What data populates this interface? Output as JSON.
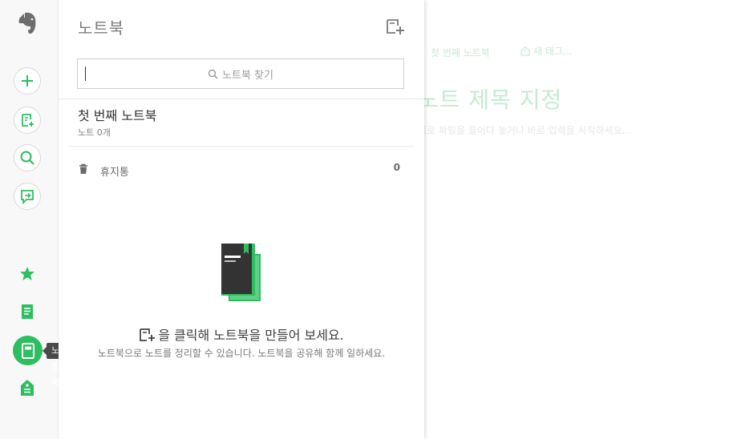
{
  "sidebar": {
    "buttons": [
      {
        "name": "new-note",
        "icon": "plus-icon"
      },
      {
        "name": "new-chat",
        "icon": "note-plus-icon"
      },
      {
        "name": "search",
        "icon": "search-icon"
      },
      {
        "name": "work-chat",
        "icon": "chat-arrow-icon"
      }
    ],
    "nav": [
      {
        "name": "shortcuts",
        "icon": "star-icon"
      },
      {
        "name": "notes",
        "icon": "notes-icon"
      },
      {
        "name": "notebooks",
        "icon": "notebook-icon",
        "active": true
      },
      {
        "name": "tags",
        "icon": "tag-icon"
      }
    ],
    "tooltip": "노트북",
    "accent_color": "#2dbe60"
  },
  "panel": {
    "title": "노트북",
    "search_placeholder": "노트북 찾기",
    "notebooks": [
      {
        "name": "첫 번째 노트북",
        "meta": "노트 0개"
      }
    ],
    "trash": {
      "label": "휴지통",
      "count": "0"
    },
    "empty": {
      "title": "을 클릭해 노트북을 만들어 보세요.",
      "desc": "노트북으로 노트를 정리할 수 있습니다. 노트북을 공유해 함께 일하세요."
    }
  },
  "background_note": {
    "crumb": "첫 번째 노트북",
    "tag_label": "새 태그...",
    "title": "노트 제목 지정",
    "desc": "기로 파일을 끌어다 놓거나 바로 입력을 시작하세요..."
  }
}
